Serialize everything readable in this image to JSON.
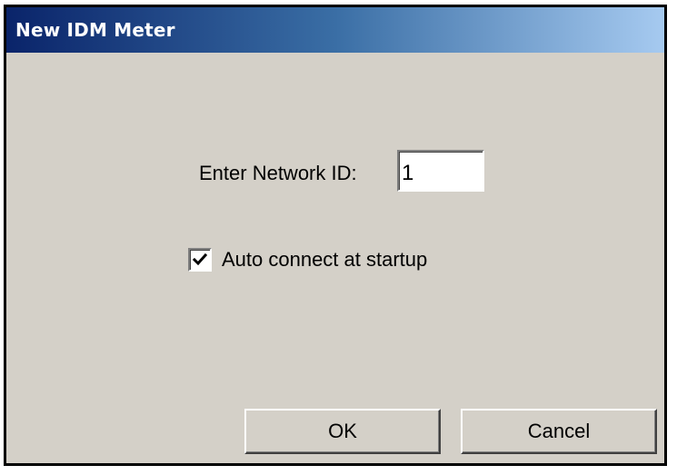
{
  "window": {
    "title": "New IDM Meter"
  },
  "form": {
    "network_id_label": "Enter Network ID:",
    "network_id_value": "1",
    "auto_connect_label": "Auto connect at startup",
    "auto_connect_checked": true
  },
  "buttons": {
    "ok_label": "OK",
    "cancel_label": "Cancel"
  },
  "colors": {
    "titlebar_start": "#0a246a",
    "titlebar_end": "#a6caf0",
    "dialog_bg": "#d4d0c8"
  },
  "icons": {
    "checkmark": "checkmark-icon"
  }
}
